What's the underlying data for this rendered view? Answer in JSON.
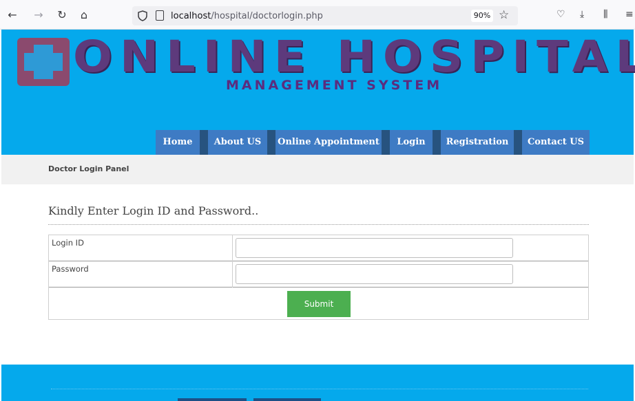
{
  "browser": {
    "url_host": "localhost",
    "url_path": "/hospital/doctorlogin.php",
    "zoom": "90%"
  },
  "header": {
    "logo_title": "ONLINE HOSPITAL",
    "logo_subtitle": "MANAGEMENT SYSTEM",
    "nav": [
      "Home",
      "About US",
      "Online Appointment",
      "Login",
      "Registration",
      "Contact US"
    ]
  },
  "breadcrumb": {
    "title": "Doctor Login Panel"
  },
  "form": {
    "heading": "Kindly Enter Login ID and Password..",
    "login_label": "Login ID",
    "login_value": "",
    "password_label": "Password",
    "password_value": "",
    "submit_label": "Submit"
  },
  "colors": {
    "header_bg": "#05a9ec",
    "nav_bg": "#3e7bc4",
    "submit_bg": "#4caf50"
  }
}
